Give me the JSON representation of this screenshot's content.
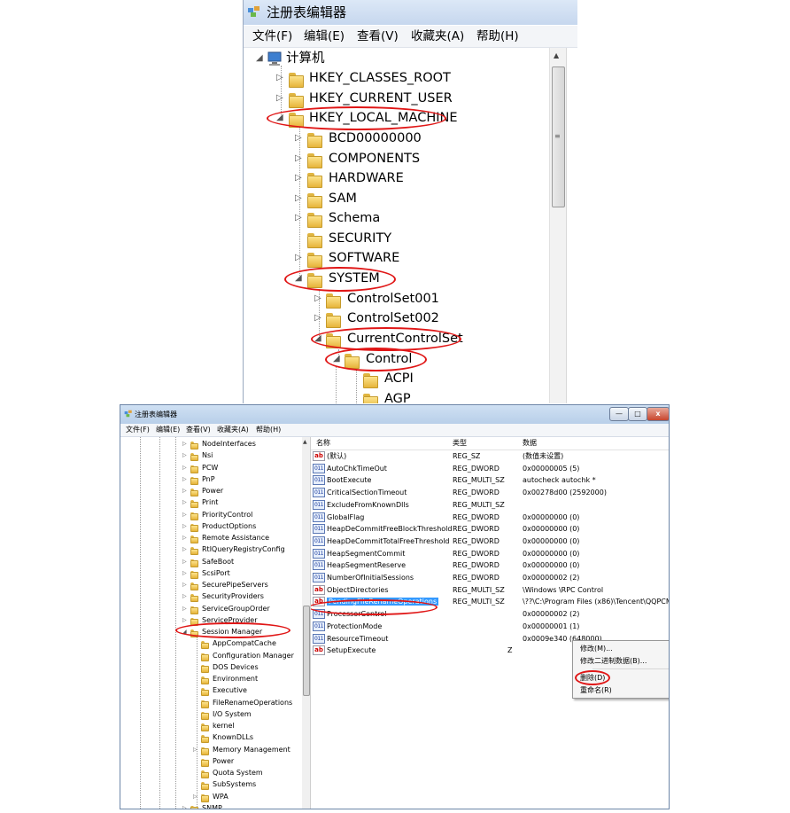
{
  "top_window": {
    "title": "注册表编辑器",
    "menu": [
      "文件(F)",
      "编辑(E)",
      "查看(V)",
      "收藏夹(A)",
      "帮助(H)"
    ],
    "tree": {
      "root": "计算机",
      "hives": [
        "HKEY_CLASSES_ROOT",
        "HKEY_CURRENT_USER",
        "HKEY_LOCAL_MACHINE"
      ],
      "hklm_children": [
        "BCD00000000",
        "COMPONENTS",
        "HARDWARE",
        "SAM",
        "Schema",
        "SECURITY",
        "SOFTWARE",
        "SYSTEM"
      ],
      "system_children": [
        "ControlSet001",
        "ControlSet002",
        "CurrentControlSet"
      ],
      "ccs_children": [
        "Control"
      ],
      "control_children": [
        "ACPI",
        "AGP"
      ]
    },
    "highlighted": [
      "HKEY_LOCAL_MACHINE",
      "SYSTEM",
      "CurrentControlSet",
      "Control"
    ]
  },
  "bottom_window": {
    "title": "注册表编辑器",
    "window_buttons": {
      "minimize": "—",
      "maximize": "□",
      "close": "x"
    },
    "menu": [
      "文件(F)",
      "编辑(E)",
      "查看(V)",
      "收藏夹(A)",
      "帮助(H)"
    ],
    "tree_items": [
      "NodeInterfaces",
      "Nsi",
      "PCW",
      "PnP",
      "Power",
      "Print",
      "PriorityControl",
      "ProductOptions",
      "Remote Assistance",
      "RtlQueryRegistryConfig",
      "SafeBoot",
      "ScsiPort",
      "SecurePipeServers",
      "SecurityProviders",
      "ServiceGroupOrder",
      "ServiceProvider",
      "Session Manager"
    ],
    "session_children": [
      "AppCompatCache",
      "Configuration Manager",
      "DOS Devices",
      "Environment",
      "Executive",
      "FileRenameOperations",
      "I/O System",
      "kernel",
      "KnownDLLs",
      "Memory Management",
      "Power",
      "Quota System",
      "SubSystems",
      "WPA"
    ],
    "tree_last": "SNMP",
    "columns": [
      "名称",
      "类型",
      "数据"
    ],
    "values": [
      {
        "icon": "ab",
        "name": "(默认)",
        "type": "REG_SZ",
        "data": "(数值未设置)"
      },
      {
        "icon": "bin",
        "name": "AutoChkTimeOut",
        "type": "REG_DWORD",
        "data": "0x00000005 (5)"
      },
      {
        "icon": "bin",
        "name": "BootExecute",
        "type": "REG_MULTI_SZ",
        "data": "autocheck autochk *"
      },
      {
        "icon": "bin",
        "name": "CriticalSectionTimeout",
        "type": "REG_DWORD",
        "data": "0x00278d00 (2592000)"
      },
      {
        "icon": "bin",
        "name": "ExcludeFromKnownDlls",
        "type": "REG_MULTI_SZ",
        "data": ""
      },
      {
        "icon": "bin",
        "name": "GlobalFlag",
        "type": "REG_DWORD",
        "data": "0x00000000 (0)"
      },
      {
        "icon": "bin",
        "name": "HeapDeCommitFreeBlockThreshold",
        "type": "REG_DWORD",
        "data": "0x00000000 (0)"
      },
      {
        "icon": "bin",
        "name": "HeapDeCommitTotalFreeThreshold",
        "type": "REG_DWORD",
        "data": "0x00000000 (0)"
      },
      {
        "icon": "bin",
        "name": "HeapSegmentCommit",
        "type": "REG_DWORD",
        "data": "0x00000000 (0)"
      },
      {
        "icon": "bin",
        "name": "HeapSegmentReserve",
        "type": "REG_DWORD",
        "data": "0x00000000 (0)"
      },
      {
        "icon": "bin",
        "name": "NumberOfInitialSessions",
        "type": "REG_DWORD",
        "data": "0x00000002 (2)"
      },
      {
        "icon": "ab",
        "name": "ObjectDirectories",
        "type": "REG_MULTI_SZ",
        "data": "\\Windows \\RPC Control"
      },
      {
        "icon": "ab",
        "name": "PendingFileRenameOperations",
        "type": "REG_MULTI_SZ",
        "data": "\\??\\C:\\Program Files (x86)\\Tencent\\QQPCM"
      },
      {
        "icon": "bin",
        "name": "ProcessorControl",
        "type": "",
        "data": "0x00000002 (2)"
      },
      {
        "icon": "bin",
        "name": "ProtectionMode",
        "type": "",
        "data": "0x00000001 (1)"
      },
      {
        "icon": "bin",
        "name": "ResourceTimeout",
        "type": "",
        "data": "0x0009e340 (648000)"
      },
      {
        "icon": "ab",
        "name": "SetupExecute",
        "type": "Z",
        "data": ""
      }
    ],
    "context_menu": [
      "修改(M)...",
      "修改二进制数据(B)...",
      "删除(D)",
      "重命名(R)"
    ]
  }
}
